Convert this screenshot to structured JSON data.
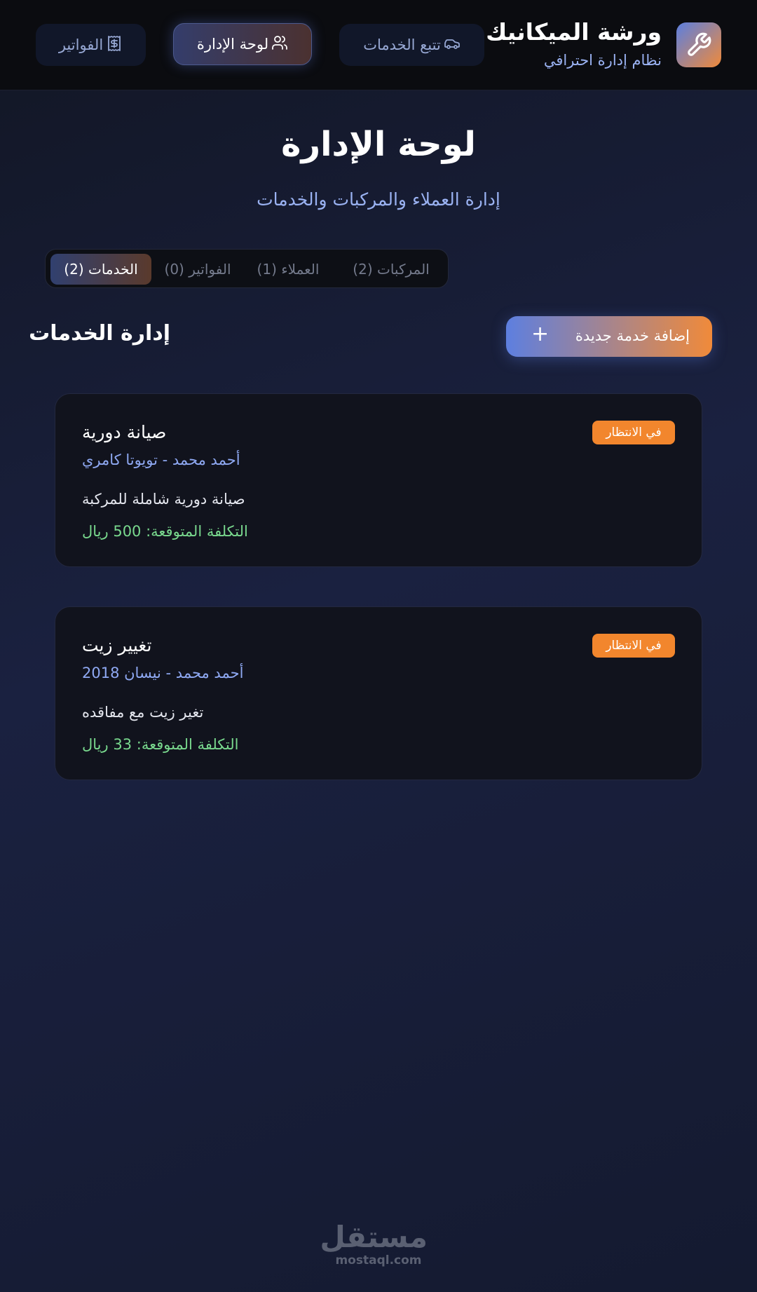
{
  "header": {
    "brand_title": "ورشة الميكانيك",
    "brand_subtitle": "نظام إدارة احترافي",
    "logo_icon": "wrench-icon",
    "nav": [
      {
        "label": "تتبع الخدمات",
        "icon": "car-icon"
      },
      {
        "label": "لوحة الإدارة",
        "icon": "users-icon",
        "active": true
      },
      {
        "label": "الفواتير",
        "icon": "receipt-icon"
      }
    ]
  },
  "page": {
    "title": "لوحة الإدارة",
    "subtitle": "إدارة العملاء والمركبات والخدمات"
  },
  "tabs": [
    {
      "label": "المركبات (2)"
    },
    {
      "label": "العملاء (1)"
    },
    {
      "label": "الفواتير (0)"
    },
    {
      "label": "الخدمات (2)",
      "active": true
    }
  ],
  "section": {
    "title": "إدارة الخدمات",
    "add_button": "إضافة خدمة جديدة",
    "add_icon": "+"
  },
  "services": [
    {
      "title": "صيانة دورية",
      "meta": "أحمد محمد - تويوتا كامري",
      "description": "صيانة دورية شاملة للمركبة",
      "cost": "التكلفة المتوقعة: 500 ريال",
      "status": "في الانتظار"
    },
    {
      "title": "تغيير زيت",
      "meta": "أحمد محمد - نيسان 2018",
      "description": "تغير زيت مع مفاقده",
      "cost": "التكلفة المتوقعة: 33 ريال",
      "status": "في الانتظار"
    }
  ],
  "watermark": {
    "ar": "مستقل",
    "en": "mostaql.com"
  },
  "colors": {
    "accent_blue": "#5b7fe0",
    "accent_orange": "#f08a3a",
    "status_pending": "#f2862d",
    "cost_green": "#79d98e",
    "meta_blue": "#8fa9f3"
  }
}
